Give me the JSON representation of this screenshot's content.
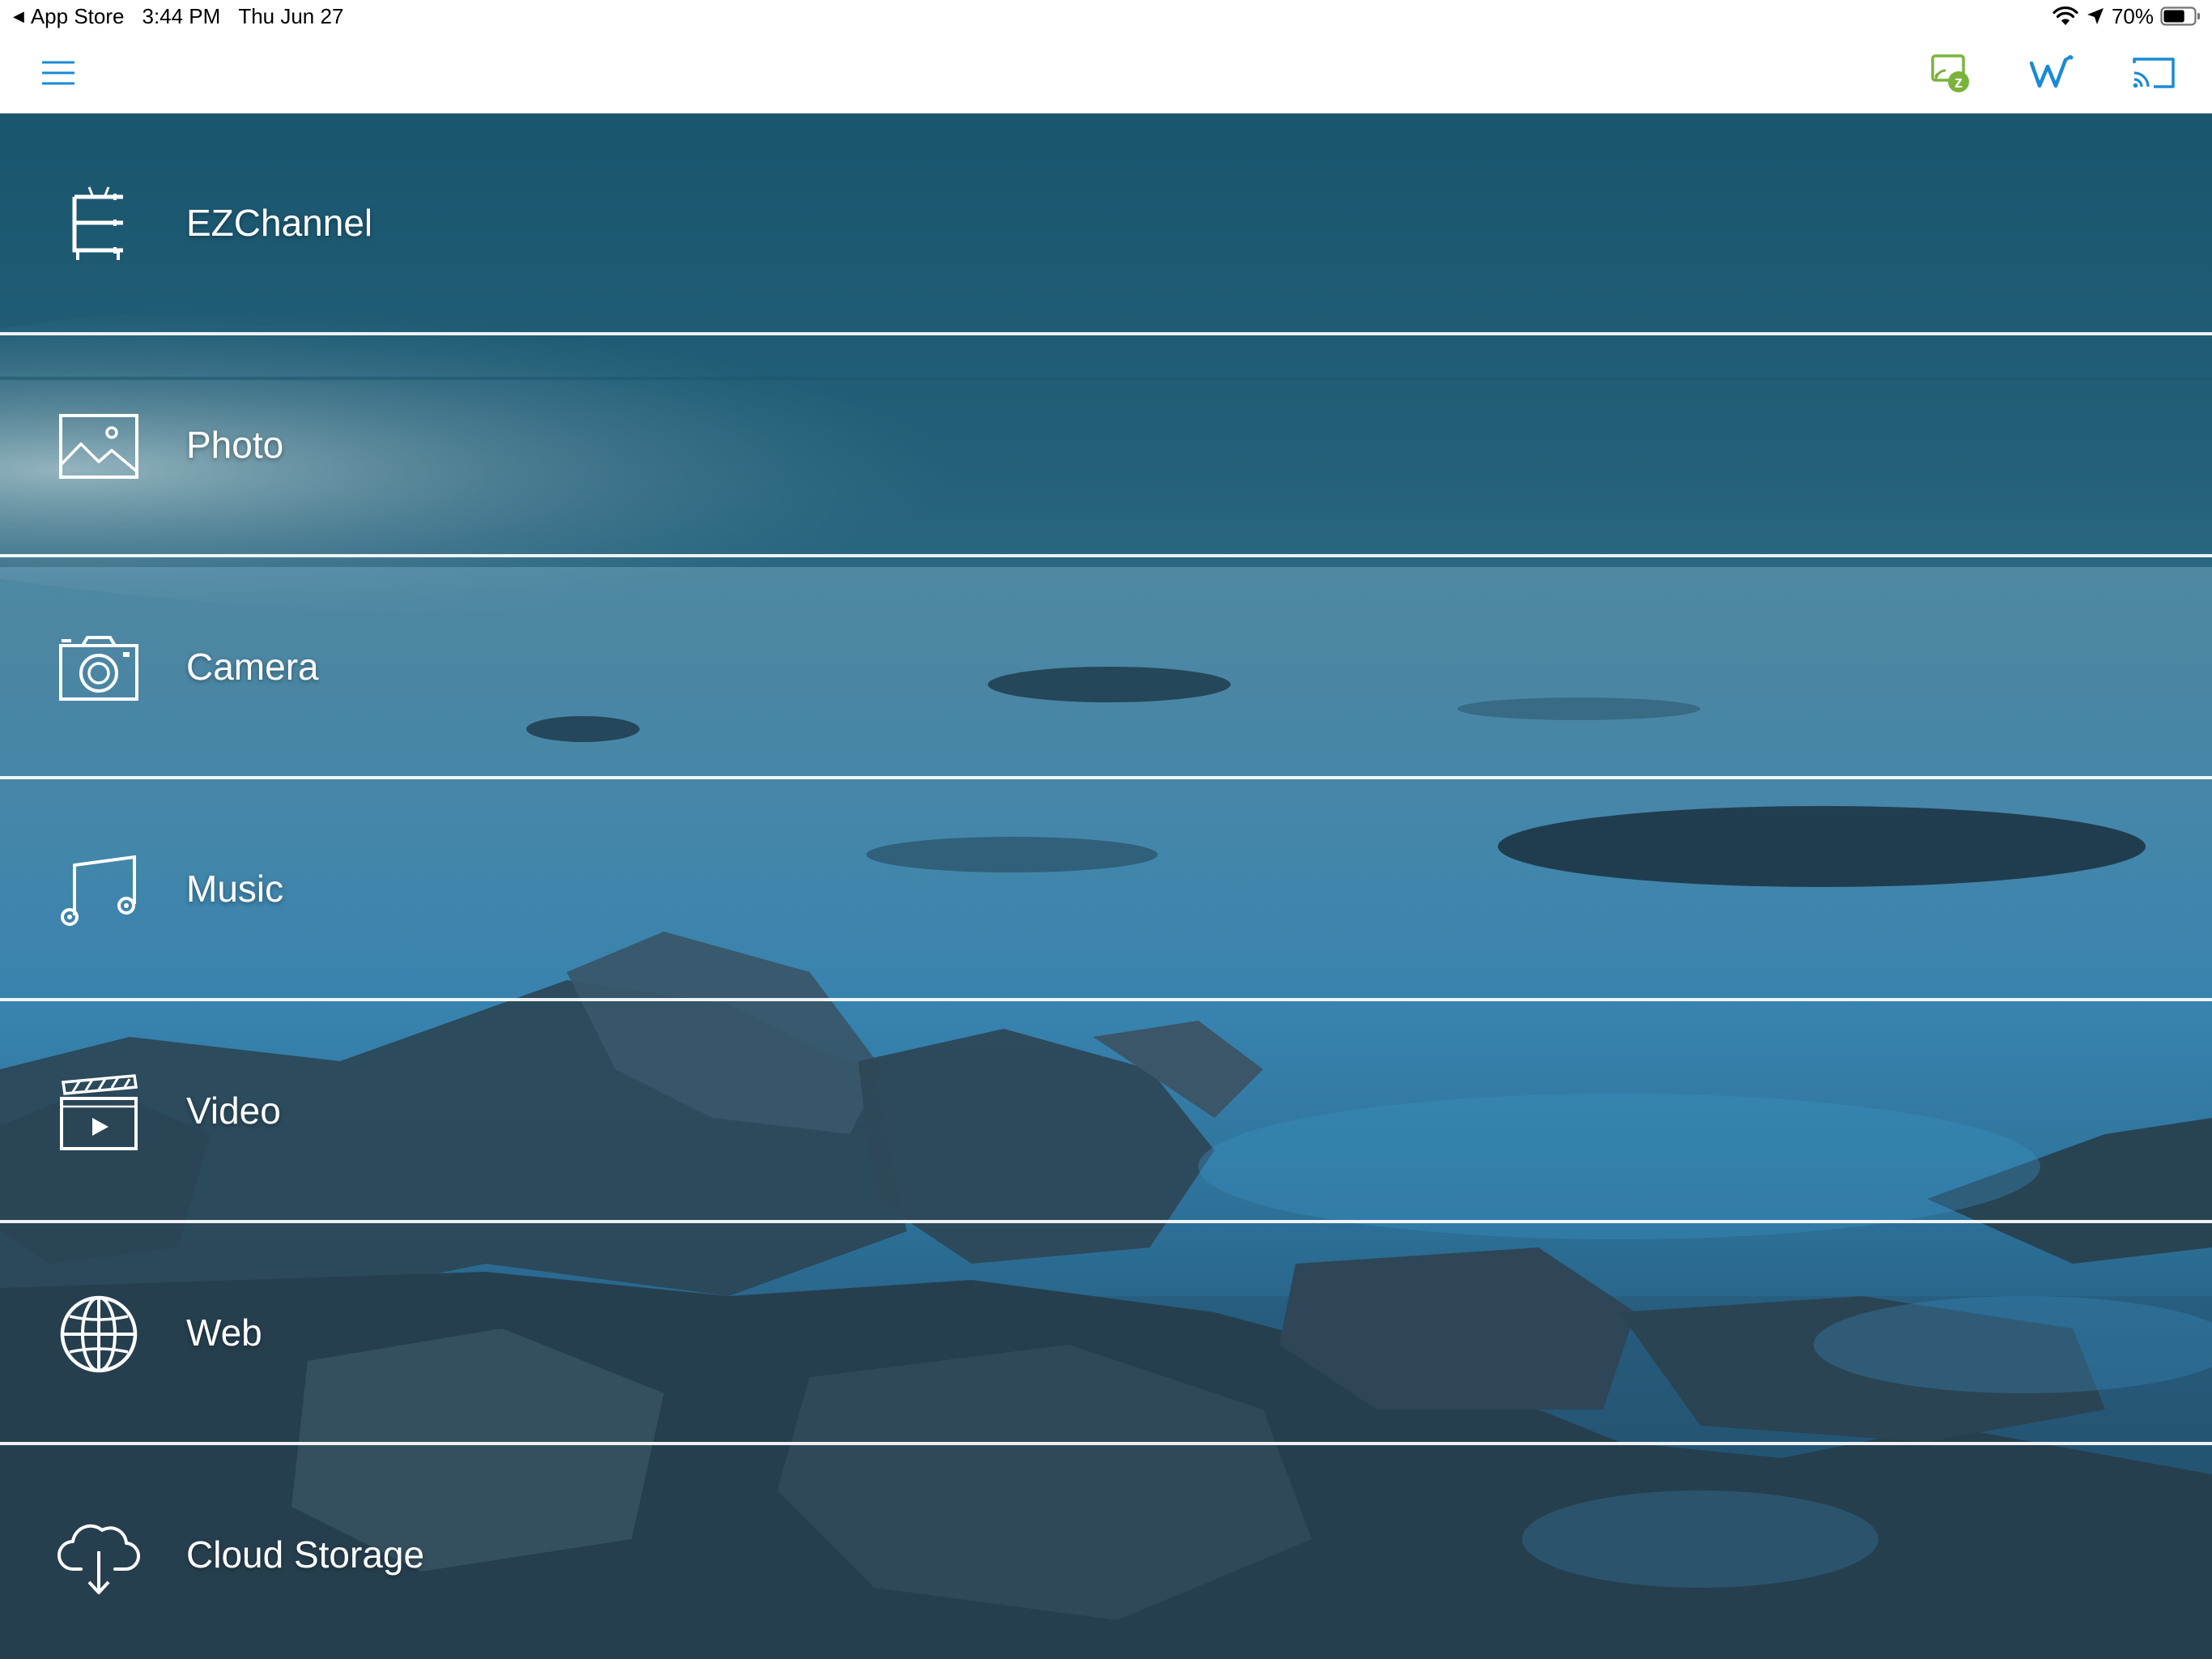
{
  "status_bar": {
    "back_app": "App Store",
    "time": "3:44 PM",
    "date": "Thu Jun 27",
    "battery_percent": "70%",
    "battery_level": 0.7,
    "icons": [
      "wifi-icon",
      "location-arrow-icon",
      "battery-icon"
    ]
  },
  "nav_bar": {
    "left_icon": "hamburger-menu-icon",
    "right_icons": [
      "ezcast-screen-icon",
      "wifi-direct-w-icon",
      "screen-cast-icon"
    ],
    "accent_color": "#1a8ad6",
    "ezcast_color": "#7ab33c"
  },
  "menu": {
    "items": [
      {
        "label": "EZChannel",
        "icon": "ezchannel-tv-icon"
      },
      {
        "label": "Photo",
        "icon": "photo-icon"
      },
      {
        "label": "Camera",
        "icon": "camera-icon"
      },
      {
        "label": "Music",
        "icon": "music-note-icon"
      },
      {
        "label": "Video",
        "icon": "video-clapper-icon"
      },
      {
        "label": "Web",
        "icon": "globe-icon"
      },
      {
        "label": "Cloud Storage",
        "icon": "cloud-download-icon"
      }
    ],
    "text_color": "#ffffff"
  }
}
